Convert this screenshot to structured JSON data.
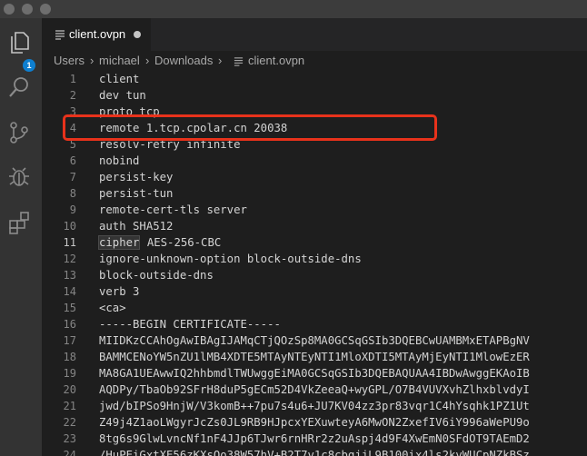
{
  "tab": {
    "label": "client.ovpn",
    "file_icon": "lines-file-icon",
    "modified_indicator": "dirty-dot"
  },
  "explorer_badge": "1",
  "breadcrumb": {
    "items": [
      "Users",
      "michael",
      "Downloads",
      "client.ovpn"
    ]
  },
  "editor": {
    "active_line": 11,
    "lines": [
      {
        "n": "1",
        "text": "client"
      },
      {
        "n": "2",
        "text": "dev tun"
      },
      {
        "n": "3",
        "text": "proto tcp"
      },
      {
        "n": "4",
        "text": "remote 1.tcp.cpolar.cn 20038"
      },
      {
        "n": "5",
        "text": "resolv-retry infinite"
      },
      {
        "n": "6",
        "text": "nobind"
      },
      {
        "n": "7",
        "text": "persist-key"
      },
      {
        "n": "8",
        "text": "persist-tun"
      },
      {
        "n": "9",
        "text": "remote-cert-tls server"
      },
      {
        "n": "10",
        "text": "auth SHA512"
      },
      {
        "n": "11",
        "text": "cipher AES-256-CBC"
      },
      {
        "n": "12",
        "text": "ignore-unknown-option block-outside-dns"
      },
      {
        "n": "13",
        "text": "block-outside-dns"
      },
      {
        "n": "14",
        "text": "verb 3"
      },
      {
        "n": "15",
        "text": "<ca>"
      },
      {
        "n": "16",
        "text": "-----BEGIN CERTIFICATE-----"
      },
      {
        "n": "17",
        "text": "MIIDKzCCAhOgAwIBAgIJAMqCTjQOzSp8MA0GCSqGSIb3DQEBCwUAMBMxETAPBgNV"
      },
      {
        "n": "18",
        "text": "BAMMCENoYW5nZU1lMB4XDTE5MTAyNTEyNTI1MloXDTI5MTAyMjEyNTI1MlowEzER"
      },
      {
        "n": "19",
        "text": "MA8GA1UEAwwIQ2hhbmdlTWUwggEiMA0GCSqGSIb3DQEBAQUAA4IBDwAwggEKAoIB"
      },
      {
        "n": "20",
        "text": "AQDPy/TbaOb92SFrH8duP5gECm52D4VkZeeaQ+wyGPL/O7B4VUVXvhZlhxblvdyI"
      },
      {
        "n": "21",
        "text": "jwd/bIPSo9HnjW/V3komB++7pu7s4u6+JU7KV04zz3pr83vqr1C4hYsqhk1PZ1Ut"
      },
      {
        "n": "22",
        "text": "Z49j4Z1aoLWgyrJcZs0JL9RB9HJpcxYEXuwteyA6MwON2ZxefIV6iY996aWePU9o"
      },
      {
        "n": "23",
        "text": "8tg6s9GlwLvncNf1nF4JJp6TJwr6rnHRr2z2uAspj4d9F4XwEmN0SFdOT9TAEmD2"
      },
      {
        "n": "24",
        "text": "/HuPEiGxtXE56zKXsOo38W57hV+B2T7v1c8cbqjjL9B100ix4ls2kvWUCpNZkBSz"
      }
    ]
  },
  "colors": {
    "accent_badge": "#0e7fd0",
    "highlight_box": "#e8321b"
  }
}
